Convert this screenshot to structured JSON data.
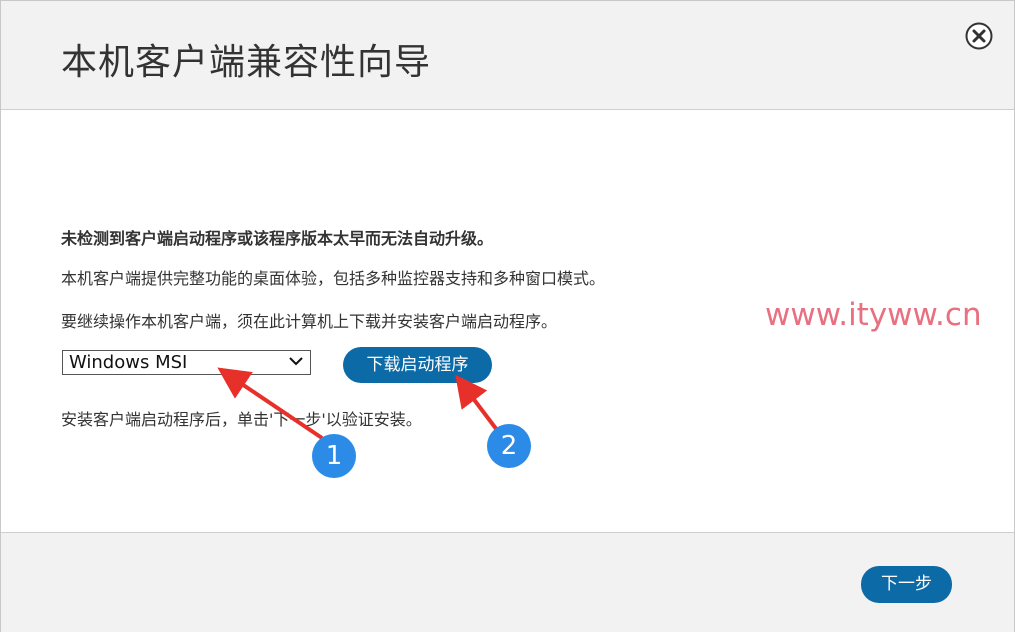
{
  "dialog": {
    "title": "本机客户端兼容性向导",
    "close_icon": "close-circle-icon"
  },
  "content": {
    "heading": "未检测到客户端启动程序或该程序版本太早而无法自动升级。",
    "line1": "本机客户端提供完整功能的桌面体验，包括多种监控器支持和多种窗口模式。",
    "line2": "要继续操作本机客户端，须在此计算机上下载并安装客户端启动程序。",
    "installer_select_value": "Windows MSI",
    "download_button": "下载启动程序",
    "instructions": "安装客户端启动程序后，单击'下一步'以验证安装。"
  },
  "footer": {
    "next_button": "下一步"
  },
  "annotations": {
    "badge1": "1",
    "badge2": "2",
    "arrow_color": "#e8302a",
    "badge_color": "#2b8be6"
  },
  "watermark": "www.ityww.cn",
  "colors": {
    "accent": "#0c6aa6",
    "header_bg": "#f2f2f2"
  }
}
